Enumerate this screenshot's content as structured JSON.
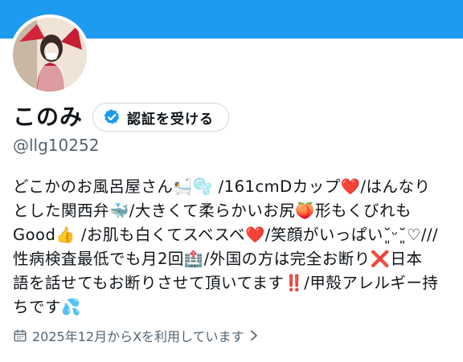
{
  "profile": {
    "display_name": "このみ",
    "handle": "@llg10252",
    "verify_button_label": "認証を受ける",
    "joined_text": "2025年12月からXを利用しています"
  },
  "bio_lines": [
    "どこかのお風呂屋さん🛀🫧 /161cmDカップ❤️/はんなり",
    "とした関西弁🐳/大きくて柔らかいお尻🍑形もくびれも",
    "Good👍 /お肌も白くてスベスベ❤️/笑顔がいっぱい˘͈ᵕ˘͈♡///",
    "性病検査最低でも月2回🏥/外国の方は完全お断り❌日本",
    "語を話せてもお断りさせて頂いてます‼️/甲殻アレルギー持",
    "ちです💦"
  ],
  "colors": {
    "banner": "#1d9bf0",
    "verified_badge": "#1d9bf0",
    "secondary_text": "#536471"
  },
  "icons": {
    "verify": "verified-badge-icon",
    "calendar": "calendar-icon",
    "chevron": "chevron-right-icon"
  }
}
